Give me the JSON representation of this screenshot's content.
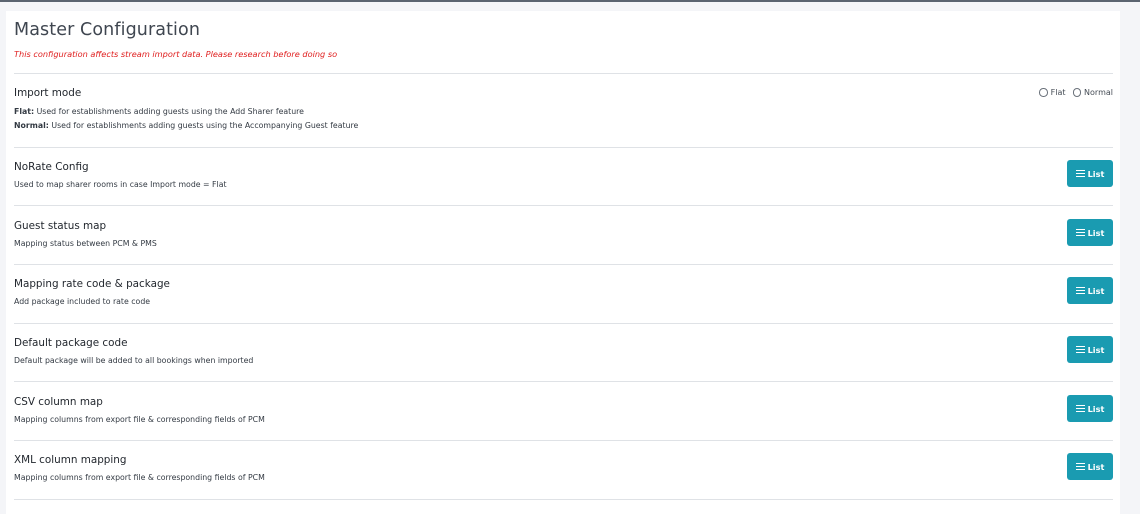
{
  "header": {
    "title": "Master Configuration",
    "warning": "This configuration affects stream import data. Please research before doing so"
  },
  "import_mode": {
    "title": "Import mode",
    "flat_label": "Flat:",
    "flat_desc": " Used for establishments adding guests using the Add Sharer feature",
    "normal_label": "Normal:",
    "normal_desc": " Used for establishments adding guests using the Accompanying Guest feature",
    "options": [
      "Flat",
      "Normal"
    ],
    "selected": null
  },
  "sections": [
    {
      "title": "NoRate Config",
      "desc": "Used to map sharer rooms in case Import mode = Flat",
      "button": "List"
    },
    {
      "title": "Guest status map",
      "desc": "Mapping status between PCM & PMS",
      "button": "List"
    },
    {
      "title": "Mapping rate code & package",
      "desc": "Add package included to rate code",
      "button": "List"
    },
    {
      "title": "Default package code",
      "desc": "Default package will be added to all bookings when imported",
      "button": "List"
    },
    {
      "title": "CSV column map",
      "desc": "Mapping columns from export file & corresponding fields of PCM",
      "button": "List"
    },
    {
      "title": "XML column mapping",
      "desc": "Mapping columns from export file & corresponding fields of PCM",
      "button": "List"
    }
  ],
  "colors": {
    "accent": "#1a9bb1",
    "warning": "#e02020"
  },
  "icons": {
    "list_button": "bars-icon",
    "radio": "radio-circle-icon"
  }
}
